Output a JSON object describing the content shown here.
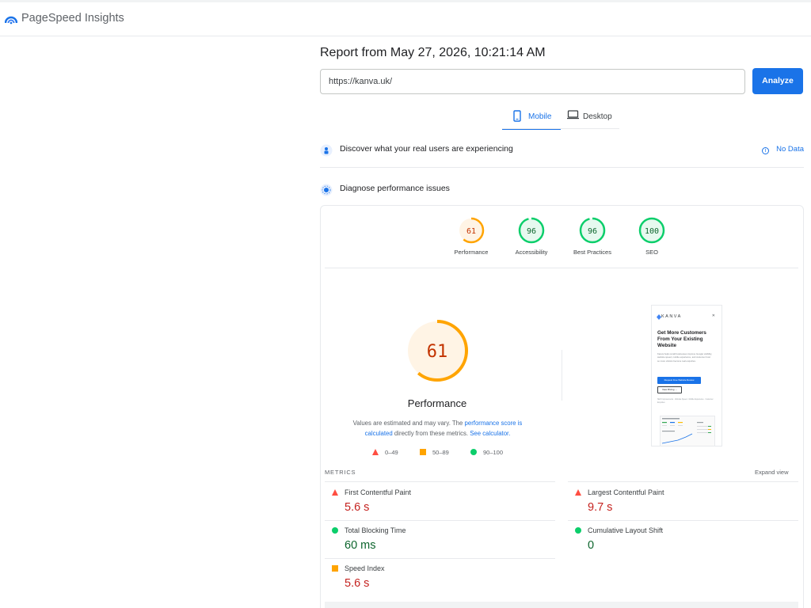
{
  "app": {
    "title": "PageSpeed Insights"
  },
  "report": {
    "title": "Report from May 27, 2026, 10:21:14 AM"
  },
  "url_input": {
    "value": "https://kanva.uk/"
  },
  "analyze_label": "Analyze",
  "tabs": [
    {
      "label": "Mobile",
      "selected": true
    },
    {
      "label": "Desktop",
      "selected": false
    }
  ],
  "sections": {
    "real_users": {
      "text": "Discover what your real users are experiencing",
      "status": "No Data"
    },
    "diagnose": {
      "text": "Diagnose performance issues"
    }
  },
  "scores": [
    {
      "value": "61",
      "label": "Performance",
      "score": 61,
      "color": "#ffa400"
    },
    {
      "value": "96",
      "label": "Accessibility",
      "score": 96,
      "color": "#0cce6b"
    },
    {
      "value": "96",
      "label": "Best Practices",
      "score": 96,
      "color": "#0cce6b"
    },
    {
      "value": "100",
      "label": "SEO",
      "score": 100,
      "color": "#0cce6b"
    }
  ],
  "performance": {
    "score": "61",
    "score_fraction": 0.61,
    "title": "Performance",
    "explanation_prefix": "Values are estimated and may vary. The ",
    "explanation_link1": "performance score is calculated",
    "explanation_middle": " directly from these metrics. ",
    "explanation_link2": "See calculator."
  },
  "legend": [
    {
      "range": "0–49",
      "shape": "triangle",
      "color": "#ff4e42"
    },
    {
      "range": "50–89",
      "shape": "square",
      "color": "#ffa400"
    },
    {
      "range": "90–100",
      "shape": "circle",
      "color": "#0cce6b"
    }
  ],
  "screenshot": {
    "logo": "KANVA",
    "heading": "Get More Customers From Your Existing Website",
    "paragraph": "Kanva helps small businesses improve Google visibility, website speed, mobile experience, and customer trust so more visitors become real enquiries.",
    "primary_button": "Request Free Website Review",
    "secondary_button": "View Pricing →",
    "small_text": "SEO Improvements · Website Speed · Mobile Experience · Customer Enquiries"
  },
  "metrics": {
    "label": "METRICS",
    "expand": "Expand view",
    "items": [
      {
        "name": "First Contentful Paint",
        "value": "5.6 s",
        "rating": "poor"
      },
      {
        "name": "Largest Contentful Paint",
        "value": "9.7 s",
        "rating": "poor"
      },
      {
        "name": "Total Blocking Time",
        "value": "60 ms",
        "rating": "good"
      },
      {
        "name": "Cumulative Layout Shift",
        "value": "0",
        "rating": "good"
      },
      {
        "name": "Speed Index",
        "value": "5.6 s",
        "rating": "average"
      }
    ]
  },
  "colors": {
    "accent": "#1a73e8",
    "poor": "#ff4e42",
    "average": "#ffa400",
    "good": "#0cce6b"
  }
}
